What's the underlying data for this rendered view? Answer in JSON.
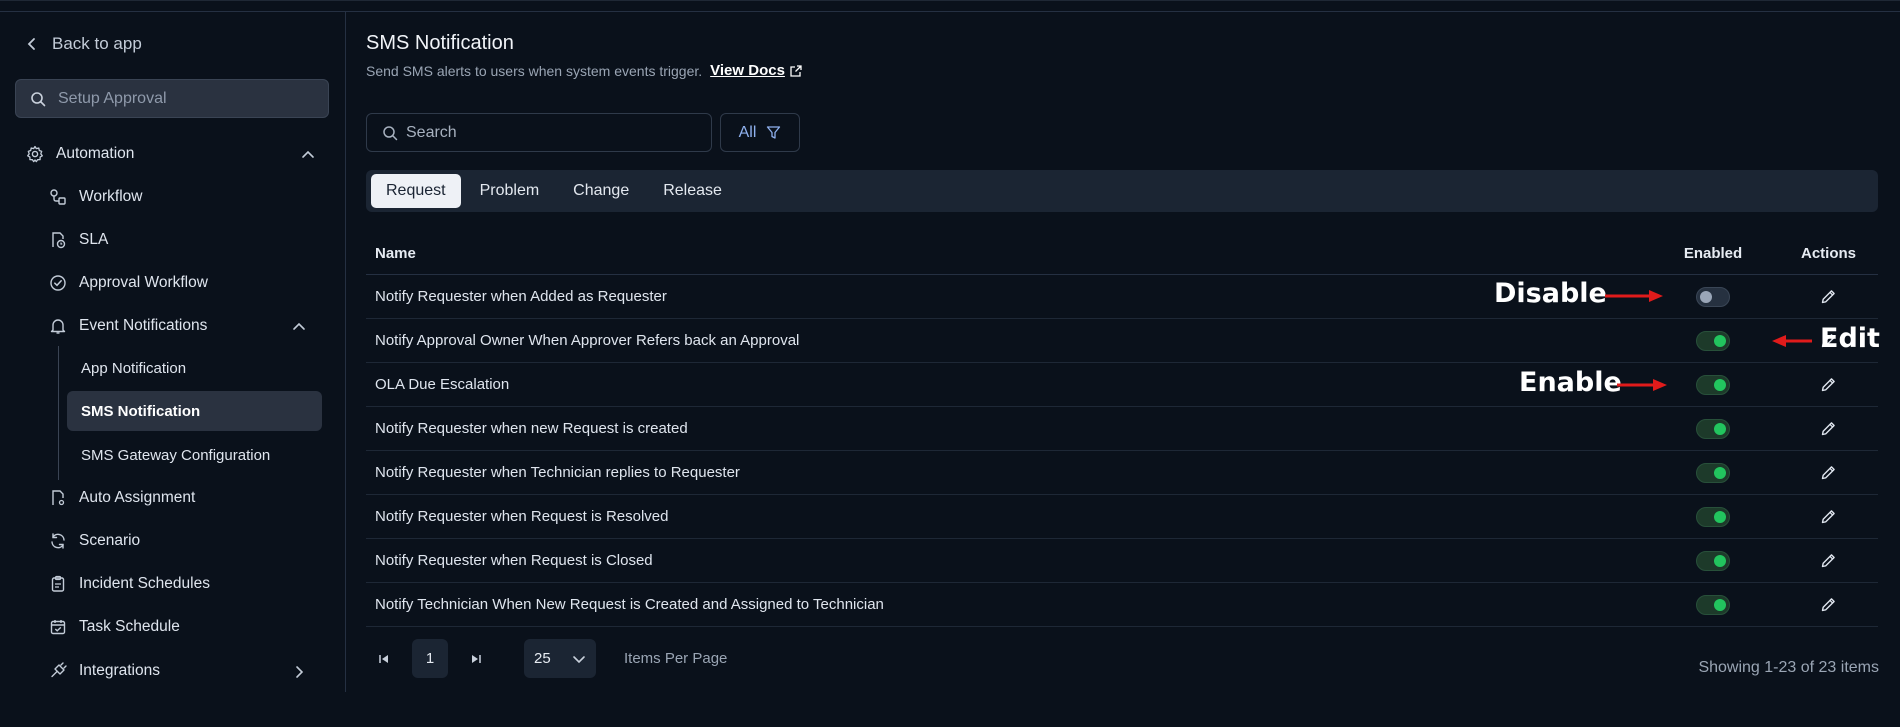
{
  "sidebar": {
    "back_label": "Back to app",
    "search_placeholder": "Setup Approval",
    "automation_label": "Automation",
    "items": [
      {
        "label": "Workflow"
      },
      {
        "label": "SLA"
      },
      {
        "label": "Approval Workflow"
      },
      {
        "label": "Event Notifications"
      },
      {
        "label": "Auto Assignment"
      },
      {
        "label": "Scenario"
      },
      {
        "label": "Incident Schedules"
      },
      {
        "label": "Task Schedule"
      },
      {
        "label": "Integrations"
      }
    ],
    "sub_items": [
      {
        "label": "App Notification"
      },
      {
        "label": "SMS Notification"
      },
      {
        "label": "SMS Gateway Configuration"
      }
    ]
  },
  "page": {
    "title": "SMS Notification",
    "subtitle": "Send SMS alerts to users when system events trigger.",
    "docs_link": "View Docs",
    "search_placeholder": "Search",
    "filter_label": "All"
  },
  "tabs": [
    {
      "label": "Request"
    },
    {
      "label": "Problem"
    },
    {
      "label": "Change"
    },
    {
      "label": "Release"
    }
  ],
  "table": {
    "headers": {
      "name": "Name",
      "enabled": "Enabled",
      "actions": "Actions"
    },
    "rows": [
      {
        "name": "Notify Requester when Added as Requester",
        "enabled": false
      },
      {
        "name": "Notify Approval Owner When Approver Refers back an Approval",
        "enabled": true
      },
      {
        "name": "OLA Due Escalation",
        "enabled": true
      },
      {
        "name": "Notify Requester when new Request is created",
        "enabled": true
      },
      {
        "name": "Notify Requester when Technician replies to Requester",
        "enabled": true
      },
      {
        "name": "Notify Requester when Request is Resolved",
        "enabled": true
      },
      {
        "name": "Notify Requester when Request is Closed",
        "enabled": true
      },
      {
        "name": "Notify Technician When New Request is Created and Assigned to Technician",
        "enabled": true
      }
    ]
  },
  "annotations": {
    "disable": "Disable",
    "edit": "Edit",
    "enable": "Enable",
    "arrow_color": "#e01b1b"
  },
  "pagination": {
    "current_page": "1",
    "per_page": "25",
    "per_page_label": "Items Per Page",
    "showing": "Showing 1-23 of 23 items"
  }
}
